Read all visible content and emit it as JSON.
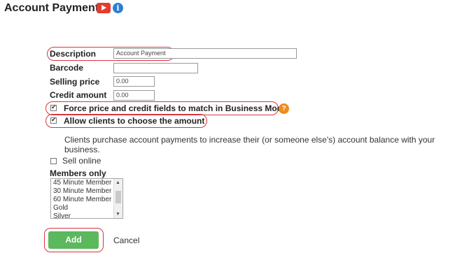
{
  "page": {
    "title": "Account Payments",
    "info_icon_glyph": "i",
    "help_icon_glyph": "?"
  },
  "form": {
    "description_label": "Description",
    "description_value": "Account Payment",
    "barcode_label": "Barcode",
    "barcode_value": "",
    "selling_price_label": "Selling price",
    "selling_price_value": "0.00",
    "credit_amount_label": "Credit amount",
    "credit_amount_value": "0.00",
    "force_match_label": "Force price and credit fields to match in Business Mode",
    "force_match_checked": true,
    "allow_choose_label": "Allow clients to choose the amount",
    "allow_choose_checked": true,
    "allow_choose_description": "Clients purchase account payments to increase their (or someone else's) account balance with your business.",
    "sell_online_label": "Sell online",
    "sell_online_checked": false,
    "members_only_label": "Members only",
    "members_options": [
      "45 Minute Member",
      "30 Minute Member",
      "60 Minute Member",
      "Gold",
      "Silver"
    ]
  },
  "actions": {
    "add_label": "Add",
    "cancel_label": "Cancel"
  },
  "colors": {
    "highlight": "#d9363e",
    "add_button": "#5cb85c",
    "youtube": "#e43c2e",
    "info": "#2b7fd1",
    "help": "#f08a1d"
  }
}
